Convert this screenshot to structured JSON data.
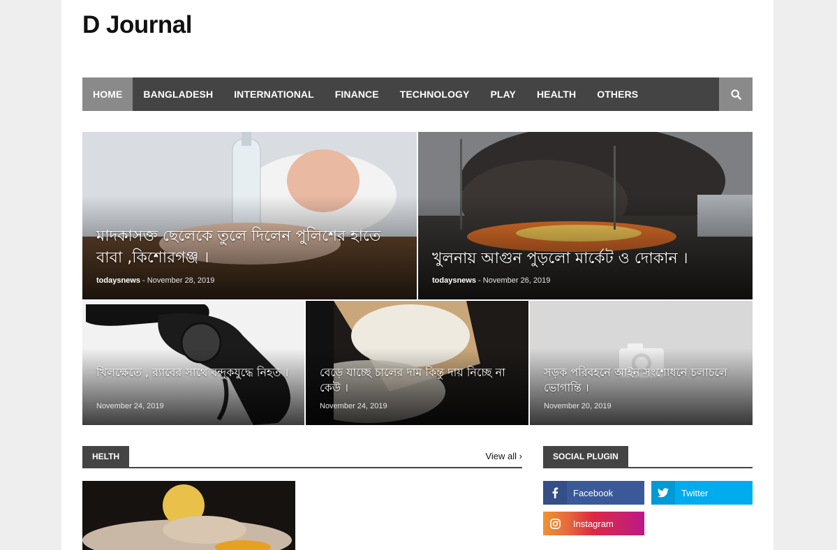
{
  "site": {
    "title": "D Journal"
  },
  "nav": {
    "items": [
      "HOME",
      "BANGLADESH",
      "INTERNATIONAL",
      "FINANCE",
      "TECHNOLOGY",
      "PLAY",
      "HEALTH",
      "OTHERS"
    ],
    "active": "HOME",
    "search_icon": "search-icon"
  },
  "featured": [
    {
      "title": "মাদকাসক্ত ছেলেকে তুলে দিলেন পুলিশের হাতে বাবা ,কিশোরগঞ্জ ।",
      "author": "todaysnews",
      "date": "November 28, 2019"
    },
    {
      "title": "খুলনায় আগুন পুড়লো মার্কেট ও দোকান ।",
      "author": "todaysnews",
      "date": "November 26, 2019"
    },
    {
      "title": "খিলক্ষেতে , র‍্যাবের সাথে বন্দুকযুদ্ধে নিহত ।",
      "date": "November 24, 2019"
    },
    {
      "title": "বেড়ে যাচ্ছে চালের দাম কিন্তু দায় নিচ্ছে না কেউ ।",
      "date": "November 24, 2019"
    },
    {
      "title": "সড়ক পরিবহনে আইন সংশোধনে চলাচলে ভোগান্তি ।",
      "date": "November 20, 2019"
    }
  ],
  "health_section": {
    "label": "HELTH",
    "view_all": "View all"
  },
  "social_section": {
    "label": "SOCIAL PLUGIN",
    "buttons": [
      {
        "label": "Facebook",
        "icon": "facebook-icon",
        "color": "#3b5998"
      },
      {
        "label": "Twitter",
        "icon": "twitter-icon",
        "color": "#00acee"
      },
      {
        "label": "Instagram",
        "icon": "instagram-icon",
        "color": "#dc2743"
      }
    ]
  }
}
